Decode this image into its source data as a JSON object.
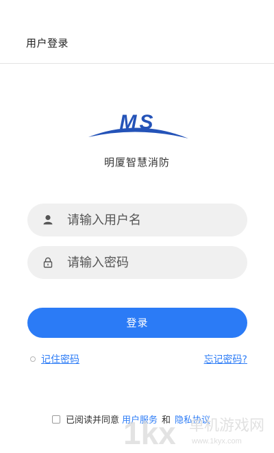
{
  "header": {
    "title": "用户登录"
  },
  "logo": {
    "text": "MS"
  },
  "app": {
    "name": "明厦智慧消防"
  },
  "form": {
    "username_placeholder": "请输入用户名",
    "password_placeholder": "请输入密码",
    "login_label": "登录",
    "remember_label": "记住密码",
    "forgot_label": "忘记密码?"
  },
  "agreement": {
    "prefix": "已阅读并同意",
    "service_link": "用户服务",
    "and": "和",
    "privacy_link": "隐私协议"
  },
  "watermark": {
    "logo_text": "1kx",
    "name": "单机游戏网",
    "url": "www.1kyx.com"
  },
  "colors": {
    "accent": "#2b7bf6",
    "logo_blue": "#2453b8",
    "input_bg": "#f0f0f0"
  },
  "icons": {
    "username": "user-icon",
    "password": "lock-icon"
  }
}
